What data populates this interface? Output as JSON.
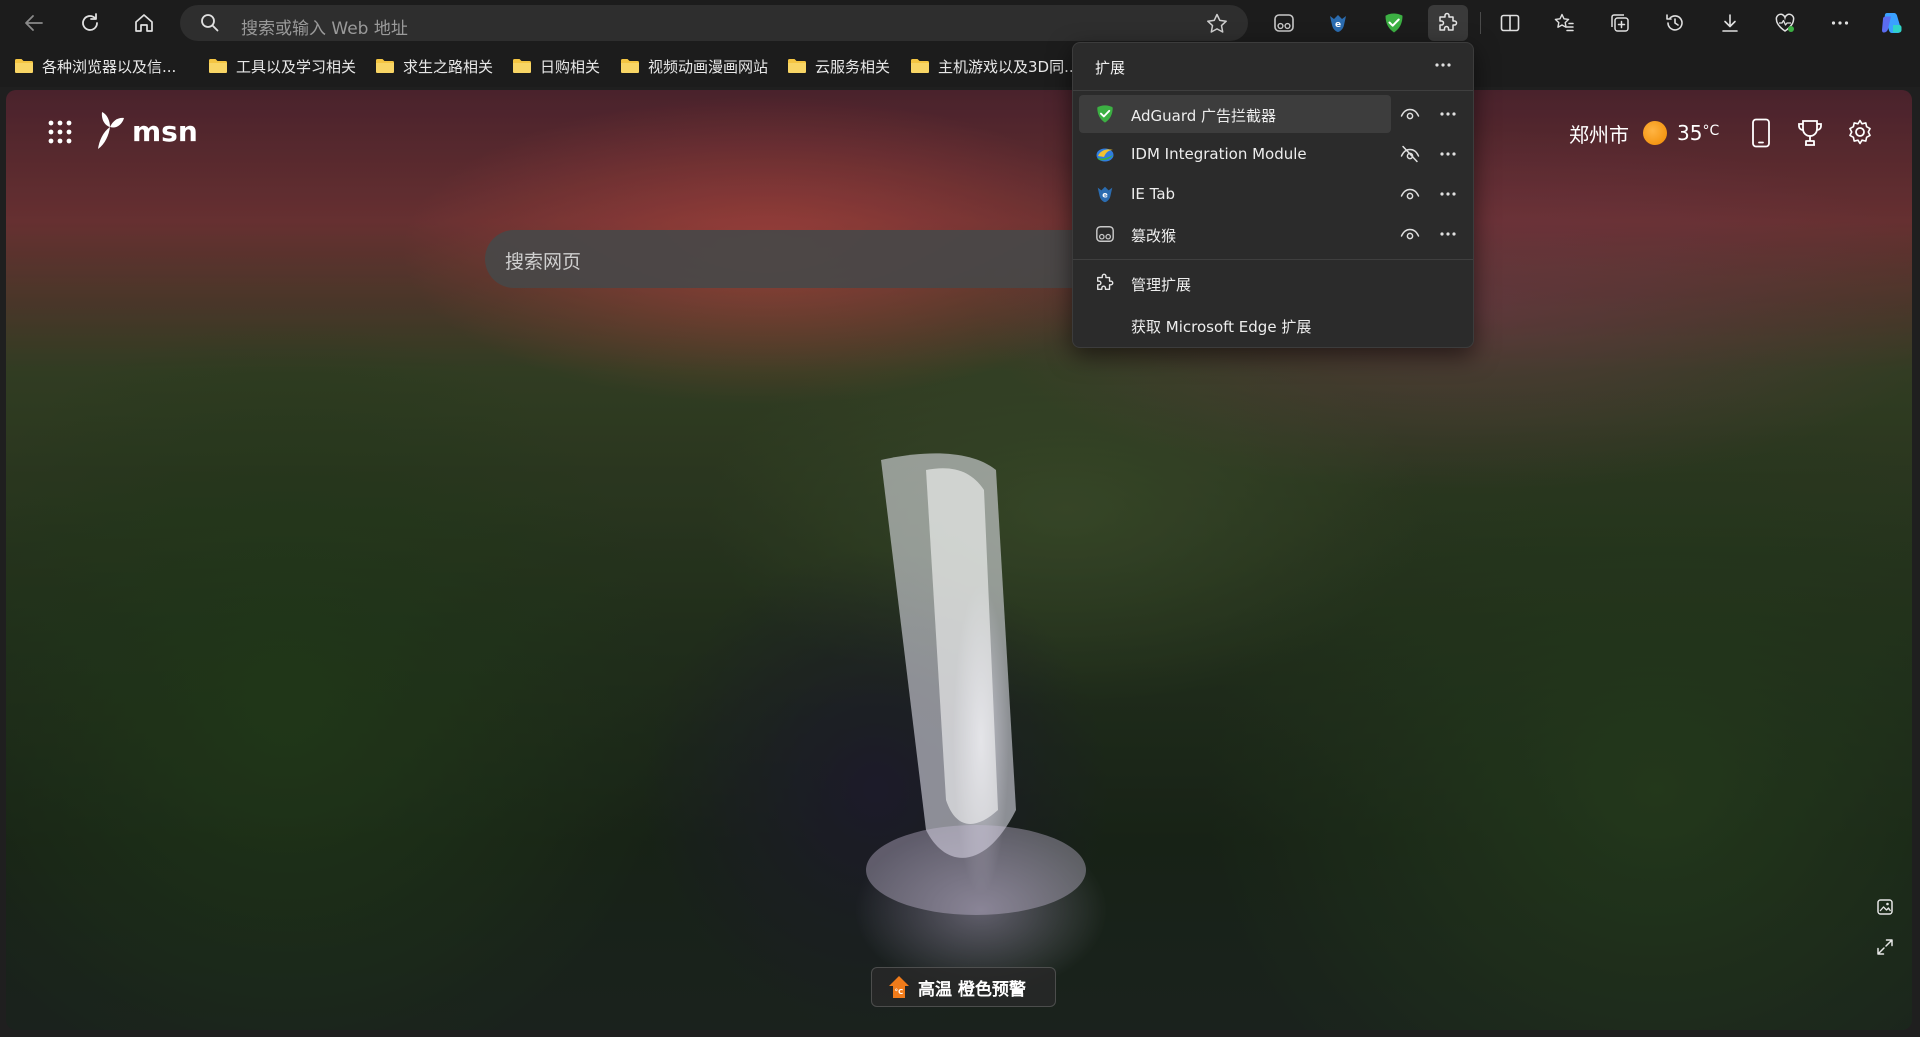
{
  "toolbar": {
    "address_placeholder": "搜索或输入 Web 地址"
  },
  "bookmarks": [
    {
      "label": "各种浏览器以及信..."
    },
    {
      "label": "工具以及学习相关"
    },
    {
      "label": "求生之路相关"
    },
    {
      "label": "日购相关"
    },
    {
      "label": "视频动画漫画网站"
    },
    {
      "label": "云服务相关"
    },
    {
      "label": "主机游戏以及3D同..."
    }
  ],
  "msn": {
    "logo_text": "msn",
    "search_placeholder": "搜索网页",
    "city": "郑州市",
    "temperature": "35",
    "temp_unit": "°C",
    "alert_text": "高温 橙色预警"
  },
  "extensions_popup": {
    "title": "扩展",
    "items": [
      {
        "label": "AdGuard 广告拦截器",
        "icon": "adguard-shield-icon",
        "visible": true
      },
      {
        "label": "IDM Integration Module",
        "icon": "idm-icon",
        "visible": false
      },
      {
        "label": "IE Tab",
        "icon": "ie-tab-icon",
        "visible": true
      },
      {
        "label": "篡改猴",
        "icon": "tampermonkey-icon",
        "visible": true
      }
    ],
    "manage_label": "管理扩展",
    "get_label": "获取 Microsoft Edge 扩展"
  },
  "colors": {
    "accent_green": "#3cb043",
    "sun_orange": "#f39b12",
    "alert_orange": "#f07b1a"
  }
}
